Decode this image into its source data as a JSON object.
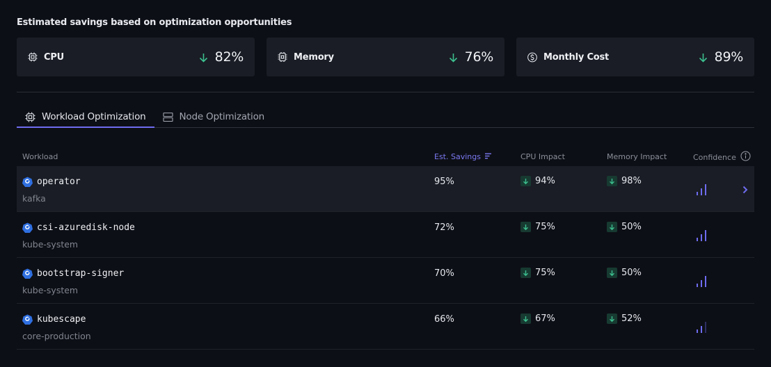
{
  "header": {
    "title": "Estimated savings based on optimization opportunities"
  },
  "summary_cards": [
    {
      "icon": "cpu-chip-icon",
      "label": "CPU",
      "direction": "down",
      "value": "82%"
    },
    {
      "icon": "memory-chip-icon",
      "label": "Memory",
      "direction": "down",
      "value": "76%"
    },
    {
      "icon": "dollar-circle-icon",
      "label": "Monthly Cost",
      "direction": "down",
      "value": "89%"
    }
  ],
  "tabs": [
    {
      "label": "Workload Optimization",
      "icon": "cpu-chip-icon",
      "active": true
    },
    {
      "label": "Node Optimization",
      "icon": "server-icon",
      "active": false
    }
  ],
  "table": {
    "columns": {
      "workload": "Workload",
      "est_savings": "Est. Savings",
      "cpu_impact": "CPU Impact",
      "memory_impact": "Memory Impact",
      "confidence": "Confidence"
    },
    "sorted_by": "Est. Savings",
    "rows": [
      {
        "name": "operator",
        "namespace": "kafka",
        "est_savings": "95%",
        "cpu_impact": "94%",
        "memory_impact": "98%",
        "confidence_level": 3,
        "confidence_max": 3,
        "highlighted": true
      },
      {
        "name": "csi-azuredisk-node",
        "namespace": "kube-system",
        "est_savings": "72%",
        "cpu_impact": "75%",
        "memory_impact": "50%",
        "confidence_level": 3,
        "confidence_max": 3,
        "highlighted": false
      },
      {
        "name": "bootstrap-signer",
        "namespace": "kube-system",
        "est_savings": "70%",
        "cpu_impact": "75%",
        "memory_impact": "50%",
        "confidence_level": 3,
        "confidence_max": 3,
        "highlighted": false
      },
      {
        "name": "kubescape",
        "namespace": "core-production",
        "est_savings": "66%",
        "cpu_impact": "67%",
        "memory_impact": "52%",
        "confidence_level": 2,
        "confidence_max": 3,
        "highlighted": false
      }
    ]
  },
  "colors": {
    "accent": "#6e6cf0",
    "down_green": "#3dbf8f",
    "down_badge_bg": "#173a31",
    "k8s_blue": "#2f6fe0"
  }
}
